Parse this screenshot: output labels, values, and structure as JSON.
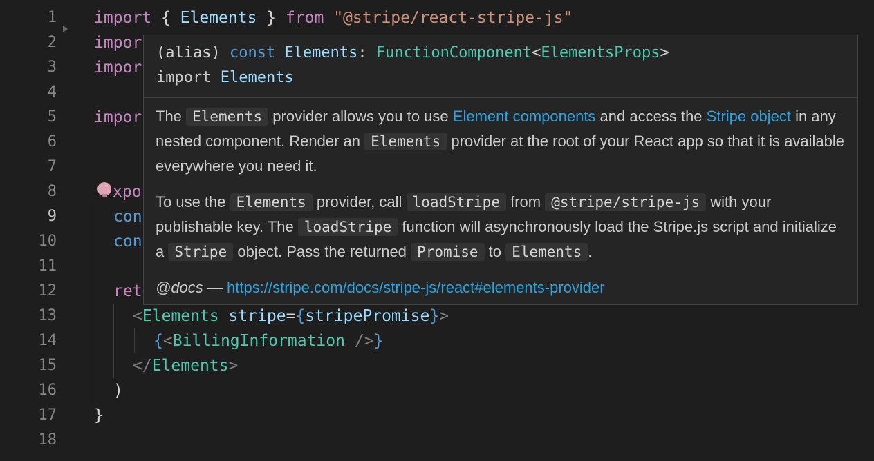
{
  "editor": {
    "line_numbers": [
      "1",
      "2",
      "3",
      "4",
      "5",
      "6",
      "7",
      "8",
      "9",
      "10",
      "11",
      "12",
      "13",
      "14",
      "15",
      "16",
      "17",
      "18"
    ],
    "active_line": "9",
    "lines": {
      "l1": {
        "kw_import": "import",
        "p1": " { ",
        "id": "Elements",
        "p2": " } ",
        "kw_from": "from",
        "str": " \"@stripe/react-stripe-js\""
      },
      "l2": {
        "text": "impor"
      },
      "l3": {
        "text": "impor"
      },
      "l5": {
        "text": "impor"
      },
      "l8": {
        "text": "xpor"
      },
      "l9": {
        "text": "con"
      },
      "l10": {
        "text": "con"
      },
      "l12": {
        "text": "ret"
      },
      "l13": {
        "lt": "<",
        "tag": "Elements",
        "attr": " stripe",
        "eq": "=",
        "open": "{",
        "val": "stripePromise",
        "close": "}",
        "gt": ">"
      },
      "l14": {
        "open": "{",
        "lt": "<",
        "tag": "BillingInformation",
        "end": " />",
        "close": "}"
      },
      "l15": {
        "lt": "</",
        "tag": "Elements",
        "gt": ">"
      },
      "l16": {
        "text": ")"
      },
      "l17": {
        "text": "}"
      }
    }
  },
  "hover": {
    "sig1": {
      "alias": "(alias) ",
      "const": "const",
      "name": " Elements",
      "colon": ": ",
      "type": "FunctionComponent",
      "lt": "<",
      "generic": "ElementsProps",
      "gt": ">"
    },
    "sig2": {
      "import": "import",
      "name": " Elements"
    },
    "p1": {
      "t1": "The ",
      "c1": "Elements",
      "t2": " provider allows you to use ",
      "link1": "Element components",
      "t3": " and access the ",
      "link2": "Stripe object",
      "t4": " in any nested component. Render an ",
      "c2": "Elements",
      "t5": " provider at the root of your React app so that it is available everywhere you need it."
    },
    "p2": {
      "t1": "To use the ",
      "c1": "Elements",
      "t2": " provider, call ",
      "c2": "loadStripe",
      "t3": " from ",
      "c3": "@stripe/stripe-js",
      "t4": " with your publishable key. The ",
      "c4": "loadStripe",
      "t5": " function will asynchronously load the Stripe.js script and initialize a ",
      "c5": "Stripe",
      "t6": " object. Pass the returned ",
      "c6": "Promise",
      "t7": " to ",
      "c7": "Elements",
      "t8": "."
    },
    "docs": {
      "tag": "@docs",
      "dash": " — ",
      "url": "https://stripe.com/docs/stripe-js/react#elements-provider"
    }
  }
}
